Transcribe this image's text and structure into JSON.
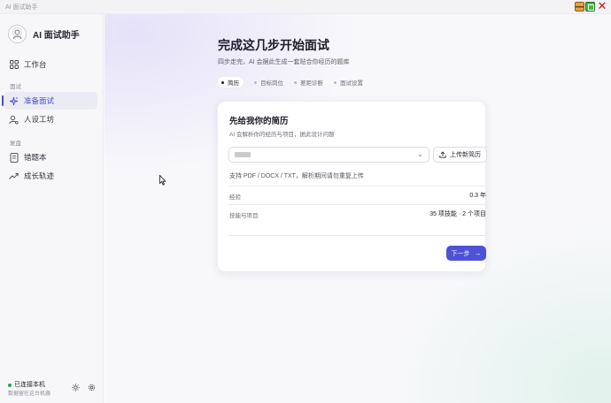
{
  "window": {
    "title": "AI 面试助手"
  },
  "sidebar": {
    "brand": "AI 面试助手",
    "items": [
      {
        "label": "工作台",
        "icon": "grid-icon",
        "active": false
      },
      {
        "label": "准备面试",
        "icon": "sparkle-icon",
        "active": true
      },
      {
        "label": "人设工坊",
        "icon": "user-gear-icon",
        "active": false
      },
      {
        "label": "错题本",
        "icon": "notebook-icon",
        "active": false
      },
      {
        "label": "成长轨迹",
        "icon": "trend-icon",
        "active": false
      }
    ],
    "sections": {
      "interview": "面试",
      "review": "复盘"
    },
    "status": {
      "title": "已连接本机",
      "subtitle": "数据留在这台机器"
    }
  },
  "main": {
    "title": "完成这几步开始面试",
    "subtitle": "四步走完，AI 会据此生成一套贴合你经历的题库",
    "steps": [
      {
        "label": "简历",
        "active": true
      },
      {
        "label": "目标岗位",
        "active": false
      },
      {
        "label": "差距诊断",
        "active": false
      },
      {
        "label": "面试设置",
        "active": false
      }
    ],
    "card": {
      "title": "先给我你的简历",
      "description": "AI 会解析你的经历与项目，据此设计问题",
      "upload_label": "上传新简历",
      "support_text": "支持 PDF / DOCX / TXT，解析期间请勿重复上传",
      "rows": [
        {
          "key": "经验",
          "value": "0.3 年"
        },
        {
          "key": "技能与项目",
          "value": "35 项技能 · 2 个项目"
        }
      ],
      "next_label": "下一步"
    }
  },
  "colors": {
    "accent": "#4d52d6",
    "status_ok": "#23a55a"
  }
}
